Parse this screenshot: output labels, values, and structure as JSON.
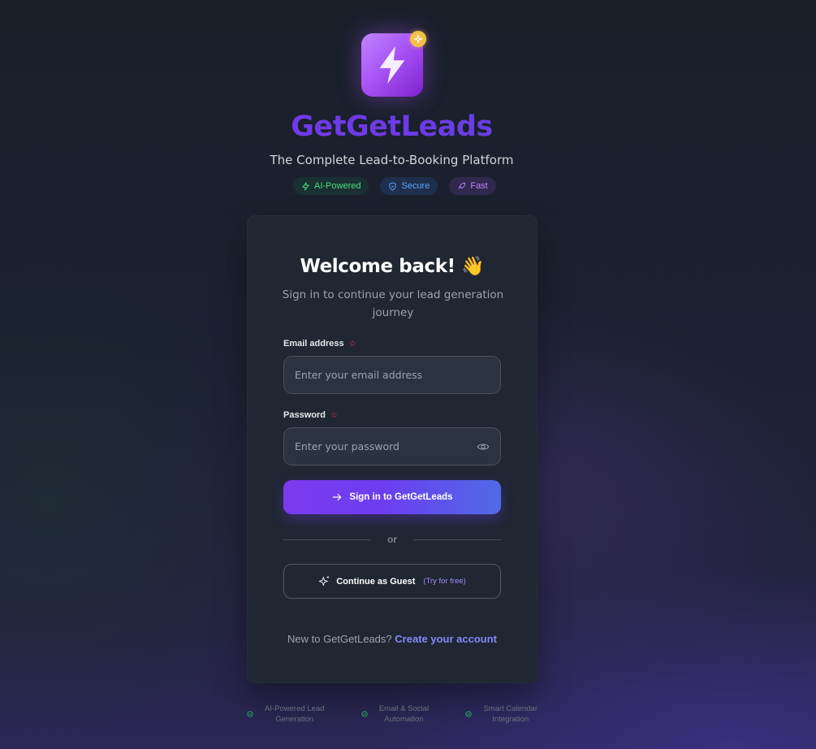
{
  "brand": {
    "name": "GetGetLeads",
    "tagline": "The Complete Lead-to-Booking Platform",
    "logo_icon": "lightning-bolt-icon",
    "badge_icon": "sparkle-icon",
    "accent": "#7c3aed"
  },
  "badges": [
    {
      "label": "AI-Powered",
      "icon": "lightning-icon",
      "color": "#4ade80"
    },
    {
      "label": "Secure",
      "icon": "shield-icon",
      "color": "#60a5fa"
    },
    {
      "label": "Fast",
      "icon": "rocket-icon",
      "color": "#c084fc"
    }
  ],
  "card": {
    "title": "Welcome back! 👋",
    "subtitle": "Sign in to continue your lead generation journey",
    "email": {
      "label": "Email address",
      "required_mark": "☆",
      "placeholder": "Enter your email address",
      "value": ""
    },
    "password": {
      "label": "Password",
      "required_mark": "☆",
      "placeholder": "Enter your password",
      "value": ""
    },
    "signin_label": "Sign in to GetGetLeads",
    "divider_text": "or",
    "guest_label": "Continue as Guest",
    "guest_hint": "(Try for free)",
    "signup_prompt": "New to GetGetLeads?",
    "signup_link": "Create your account"
  },
  "features": [
    {
      "line1": "AI-Powered Lead",
      "line2": "Generation"
    },
    {
      "line1": "Email & Social",
      "line2": "Automation"
    },
    {
      "line1": "Smart Calendar",
      "line2": "Integration"
    }
  ]
}
